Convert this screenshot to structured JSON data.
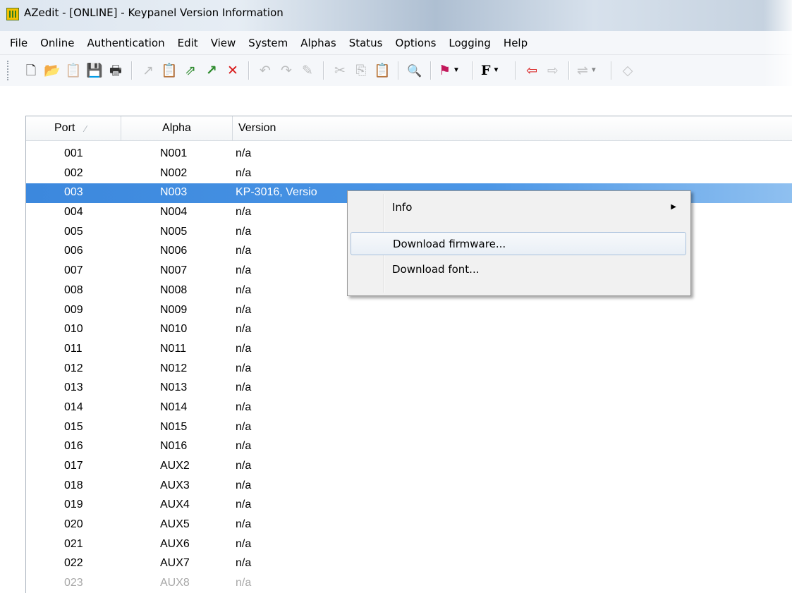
{
  "window": {
    "title": "AZedit - [ONLINE] - Keypanel Version Information"
  },
  "menubar": {
    "items": [
      "File",
      "Online",
      "Authentication",
      "Edit",
      "View",
      "System",
      "Alphas",
      "Status",
      "Options",
      "Logging",
      "Help"
    ]
  },
  "toolbar": {
    "buttons": [
      {
        "icon": "new-document-icon",
        "glyph": "🗋"
      },
      {
        "icon": "open-folder-icon",
        "glyph": "📂"
      },
      {
        "icon": "copy-config-icon",
        "glyph": "📋"
      },
      {
        "icon": "save-icon",
        "glyph": "💾"
      },
      {
        "icon": "print-icon",
        "glyph": "🖶"
      },
      {
        "icon": "online-connect-icon",
        "glyph": "↗"
      },
      {
        "icon": "paste-config-icon",
        "glyph": "📋"
      },
      {
        "icon": "upload-icon",
        "glyph": "⇗"
      },
      {
        "icon": "green-arrow-icon",
        "glyph": "↗"
      },
      {
        "icon": "disconnect-icon",
        "glyph": "✕"
      },
      {
        "icon": "undo-icon",
        "glyph": "↶"
      },
      {
        "icon": "redo-icon",
        "glyph": "↷"
      },
      {
        "icon": "edit-pen-icon",
        "glyph": "✎"
      },
      {
        "icon": "cut-icon",
        "glyph": "✂"
      },
      {
        "icon": "copy-icon",
        "glyph": "⎘"
      },
      {
        "icon": "paste-icon",
        "glyph": "📋"
      },
      {
        "icon": "search-icon",
        "glyph": "🔍"
      },
      {
        "icon": "alert-dropdown-icon",
        "glyph": "⚑"
      },
      {
        "icon": "font-dropdown-icon",
        "glyph": "F"
      },
      {
        "icon": "back-arrow-icon",
        "glyph": "⇦"
      },
      {
        "icon": "forward-arrow-icon",
        "glyph": "⇨"
      },
      {
        "icon": "network-dropdown-icon",
        "glyph": "⇌"
      },
      {
        "icon": "tag-icon",
        "glyph": "◇"
      }
    ]
  },
  "list": {
    "columns": {
      "port": "Port",
      "alpha": "Alpha",
      "version": "Version"
    },
    "rows": [
      {
        "port": "001",
        "alpha": "N001",
        "version": "n/a"
      },
      {
        "port": "002",
        "alpha": "N002",
        "version": "n/a"
      },
      {
        "port": "003",
        "alpha": "N003",
        "version": "KP-3016, Versio"
      },
      {
        "port": "004",
        "alpha": "N004",
        "version": "n/a"
      },
      {
        "port": "005",
        "alpha": "N005",
        "version": "n/a"
      },
      {
        "port": "006",
        "alpha": "N006",
        "version": "n/a"
      },
      {
        "port": "007",
        "alpha": "N007",
        "version": "n/a"
      },
      {
        "port": "008",
        "alpha": "N008",
        "version": "n/a"
      },
      {
        "port": "009",
        "alpha": "N009",
        "version": "n/a"
      },
      {
        "port": "010",
        "alpha": "N010",
        "version": "n/a"
      },
      {
        "port": "011",
        "alpha": "N011",
        "version": "n/a"
      },
      {
        "port": "012",
        "alpha": "N012",
        "version": "n/a"
      },
      {
        "port": "013",
        "alpha": "N013",
        "version": "n/a"
      },
      {
        "port": "014",
        "alpha": "N014",
        "version": "n/a"
      },
      {
        "port": "015",
        "alpha": "N015",
        "version": "n/a"
      },
      {
        "port": "016",
        "alpha": "N016",
        "version": "n/a"
      },
      {
        "port": "017",
        "alpha": "AUX2",
        "version": "n/a"
      },
      {
        "port": "018",
        "alpha": "AUX3",
        "version": "n/a"
      },
      {
        "port": "019",
        "alpha": "AUX4",
        "version": "n/a"
      },
      {
        "port": "020",
        "alpha": "AUX5",
        "version": "n/a"
      },
      {
        "port": "021",
        "alpha": "AUX6",
        "version": "n/a"
      },
      {
        "port": "022",
        "alpha": "AUX7",
        "version": "n/a"
      },
      {
        "port": "023",
        "alpha": "AUX8",
        "version": "n/a"
      }
    ],
    "selected_port": "003"
  },
  "context_menu": {
    "items": [
      {
        "label": "Info",
        "submenu": true
      },
      {
        "label": "Download firmware...",
        "submenu": false
      },
      {
        "label": "Download font...",
        "submenu": false
      }
    ],
    "highlighted": "Download firmware..."
  }
}
